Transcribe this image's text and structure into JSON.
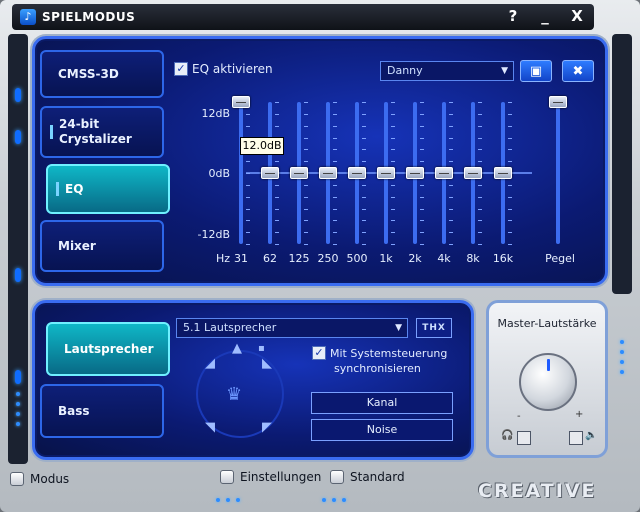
{
  "window": {
    "title": "SPIELMODUS",
    "help_label": "?",
    "minimize_label": "_",
    "close_label": "X"
  },
  "top_tabs": [
    {
      "label": "CMSS-3D",
      "active": false
    },
    {
      "label": "24-bit Crystalizer",
      "active": false
    },
    {
      "label": "EQ",
      "active": true
    },
    {
      "label": "Mixer",
      "active": false
    }
  ],
  "eq": {
    "enable_label": "EQ aktivieren",
    "enabled": true,
    "preset": "Danny",
    "db_labels": [
      "12dB",
      "0dB",
      "-12dB"
    ],
    "hz_label": "Hz",
    "tooltip": "12.0dB",
    "bands": [
      {
        "freq": "31",
        "gain_db": 12
      },
      {
        "freq": "62",
        "gain_db": 0
      },
      {
        "freq": "125",
        "gain_db": 0
      },
      {
        "freq": "250",
        "gain_db": 0
      },
      {
        "freq": "500",
        "gain_db": 0
      },
      {
        "freq": "1k",
        "gain_db": 0
      },
      {
        "freq": "2k",
        "gain_db": 0
      },
      {
        "freq": "4k",
        "gain_db": 0
      },
      {
        "freq": "8k",
        "gain_db": 0
      },
      {
        "freq": "16k",
        "gain_db": 0
      }
    ],
    "pegel_label": "Pegel",
    "pegel_level": 12
  },
  "bottom_tabs": [
    {
      "label": "Lautsprecher",
      "active": true
    },
    {
      "label": "Bass",
      "active": false
    }
  ],
  "speakers": {
    "config": "5.1 Lautsprecher",
    "thx_label": "THX",
    "sync_label_1": "Mit Systemsteuerung",
    "sync_label_2": "synchronisieren",
    "sync_checked": true,
    "kanal_label": "Kanal",
    "noise_label": "Noise"
  },
  "master": {
    "title": "Master-Lautstärke",
    "minus": "-",
    "plus": "+"
  },
  "bottom_bar": {
    "modus": "Modus",
    "einstellungen": "Einstellungen",
    "standard": "Standard",
    "brand": "CREATIVE"
  },
  "colors": {
    "panel_blue": "#0b1a72",
    "accent_cyan": "#0fb7c7",
    "track_blue": "#3c6cf0"
  }
}
